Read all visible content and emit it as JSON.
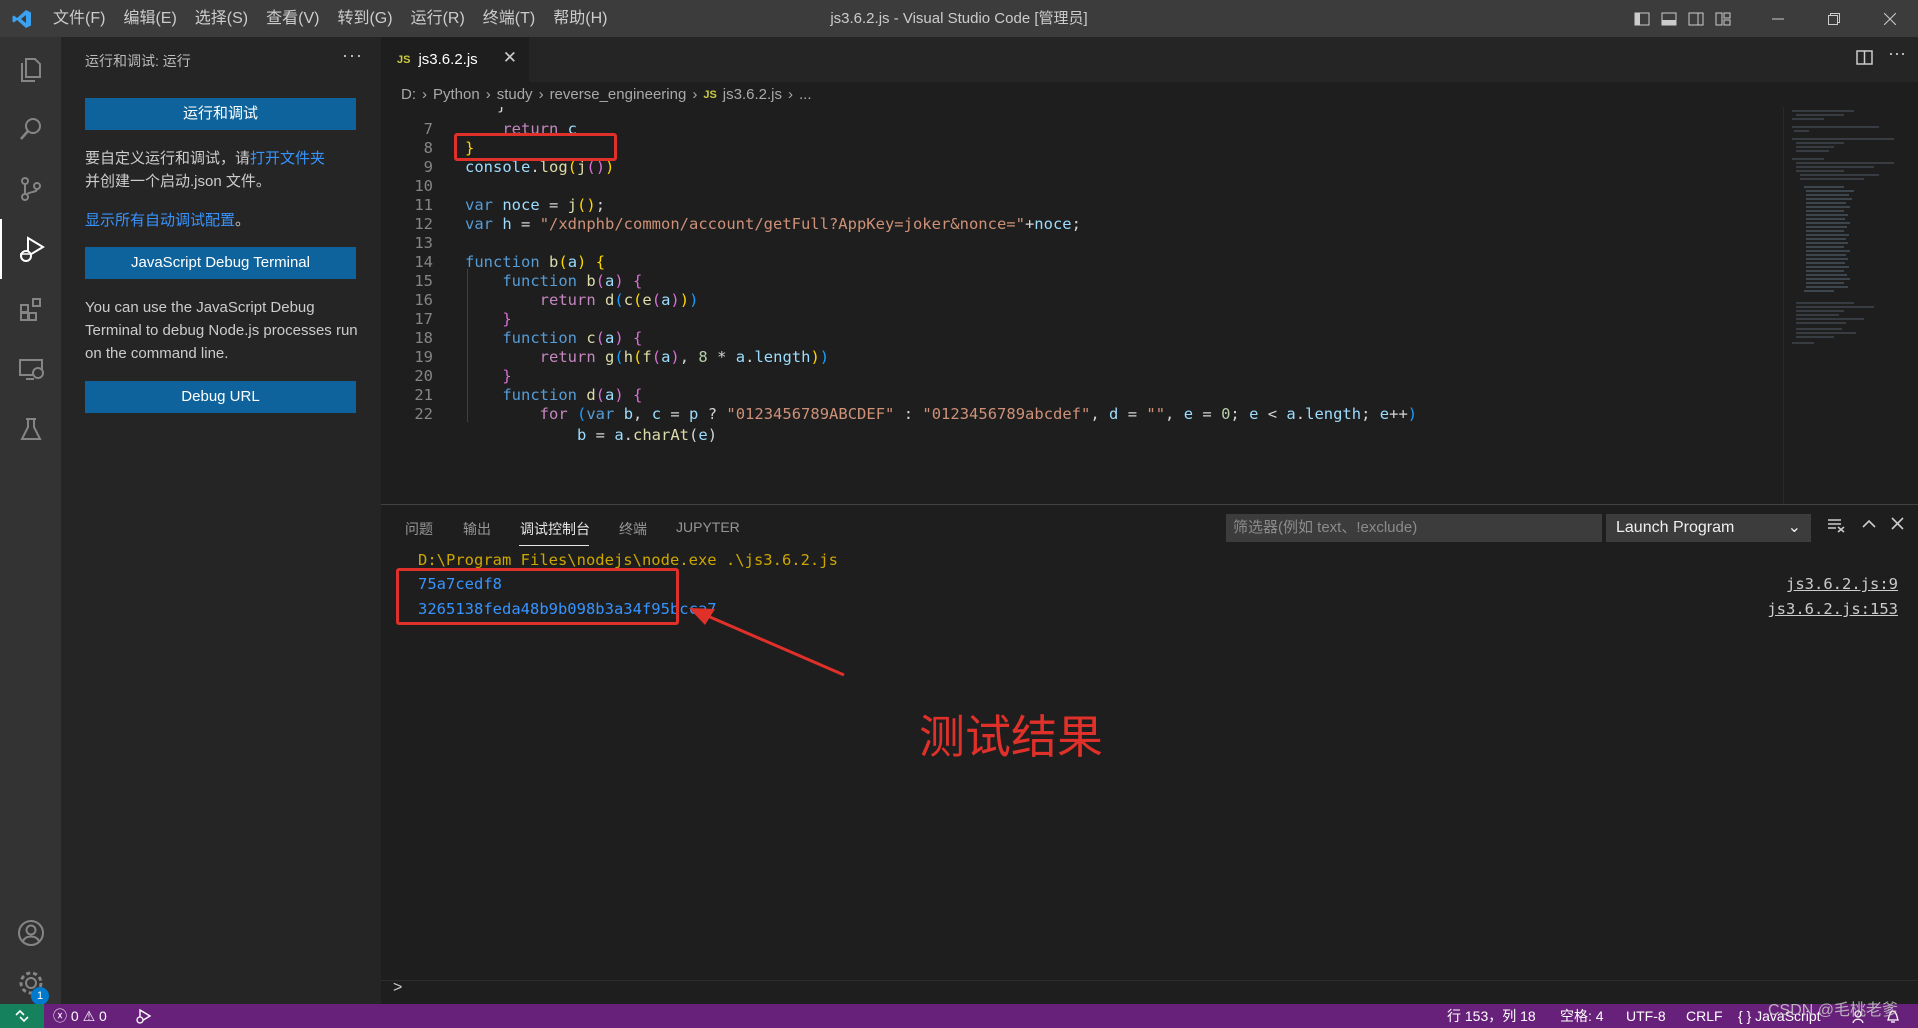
{
  "titlebar": {
    "menu": [
      "文件(F)",
      "编辑(E)",
      "选择(S)",
      "查看(V)",
      "转到(G)",
      "运行(R)",
      "终端(T)",
      "帮助(H)"
    ],
    "title": "js3.6.2.js - Visual Studio Code [管理员]"
  },
  "activity_bar": {
    "icons": [
      "explorer-icon",
      "search-icon",
      "source-control-icon",
      "run-debug-icon",
      "extensions-icon",
      "remote-explorer-icon",
      "testing-icon",
      "account-icon",
      "settings-gear-icon"
    ],
    "settings_badge": "1"
  },
  "sidebar": {
    "header": "运行和调试: 运行",
    "more": "···",
    "run_button": "运行和调试",
    "custom_text_1": "要自定义运行和调试，请",
    "open_folder_link": "打开文件夹",
    "custom_text_2": "并创建一个启动.json 文件。",
    "show_configs_link": "显示所有自动调试配置",
    "show_configs_suffix": "。",
    "js_terminal_button": "JavaScript Debug Terminal",
    "js_terminal_desc": "You can use the JavaScript Debug Terminal to debug Node.js processes run on the command line.",
    "debug_url_button": "Debug URL"
  },
  "editor": {
    "tab_badge": "JS",
    "tab_label": "js3.6.2.js",
    "breadcrumb": [
      "D:",
      "Python",
      "study",
      "reverse_engineering",
      "js3.6.2.js",
      "..."
    ],
    "lines": [
      "7",
      "8",
      "9",
      "10",
      "11",
      "12",
      "13",
      "14",
      "15",
      "16",
      "17",
      "18",
      "19",
      "20",
      "21",
      "22"
    ]
  },
  "panel": {
    "tabs": [
      "问题",
      "输出",
      "调试控制台",
      "终端",
      "JUPYTER"
    ],
    "active_tab": "调试控制台",
    "filter_placeholder": "筛选器(例如 text、!exclude)",
    "launch_config": "Launch Program",
    "command": "D:\\Program Files\\nodejs\\node.exe .\\js3.6.2.js",
    "output_1": "75a7cedf8",
    "output_1_source": "js3.6.2.js:9",
    "output_2": "3265138feda48b9b098b3a34f95bcca7",
    "output_2_source": "js3.6.2.js:153",
    "annotation": "测试结果",
    "prompt": ">"
  },
  "statusbar": {
    "errors": "0",
    "warnings": "0",
    "position": "行 153，列 18",
    "spaces": "空格: 4",
    "encoding": "UTF-8",
    "eol": "CRLF",
    "language": "{ } JavaScript"
  },
  "watermark": "CSDN @毛桃老爹",
  "colors": {
    "accent": "#0e639c",
    "statusbar": "#68217a",
    "highlight_box": "#e0302a",
    "link": "#3794ff"
  }
}
